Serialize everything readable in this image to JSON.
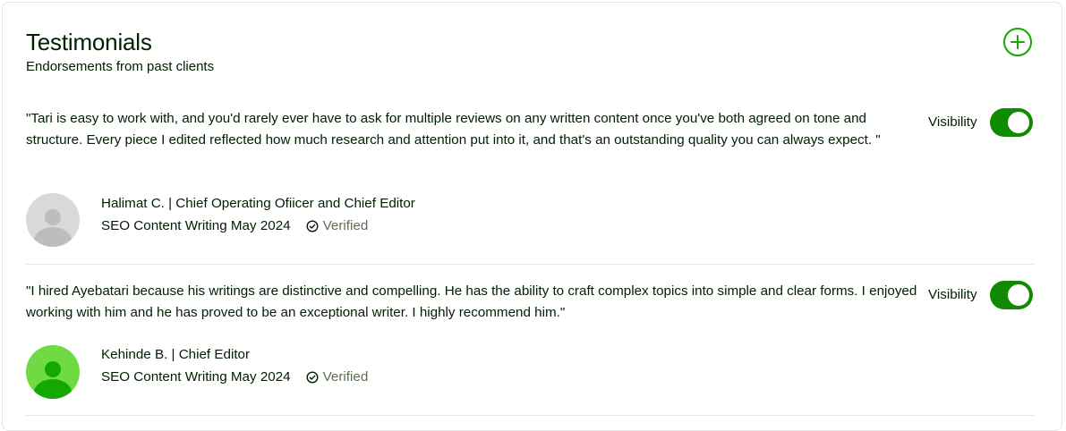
{
  "section": {
    "title": "Testimonials",
    "subtitle": "Endorsements from past clients",
    "add_icon": "plus-circle-icon"
  },
  "accent_color": "#108a00",
  "testimonials": [
    {
      "quote": "\"Tari is easy to work with, and you'd rarely ever have to ask for multiple reviews on any written content once you've both agreed on tone and structure. Every piece I edited reflected how much research and attention put into it, and that's an outstanding quality you can always expect. \"",
      "visibility_label": "Visibility",
      "visible": true,
      "author": "Halimat C. | Chief Operating Ofiicer and Chief Editor",
      "project": "SEO Content Writing May 2024",
      "verified_label": "Verified",
      "avatar_color": "#d9d9d9"
    },
    {
      "quote": "\"I hired Ayebatari because his writings are distinctive and compelling. He has the ability to craft complex topics into simple and clear forms. I enjoyed working with him and he has proved to be an exceptional writer. I highly recommend him.\"",
      "visibility_label": "Visibility",
      "visible": true,
      "author": "Kehinde B. | Chief Editor",
      "project": "SEO Content Writing May 2024",
      "verified_label": "Verified",
      "avatar_color": "#6fda44"
    }
  ]
}
